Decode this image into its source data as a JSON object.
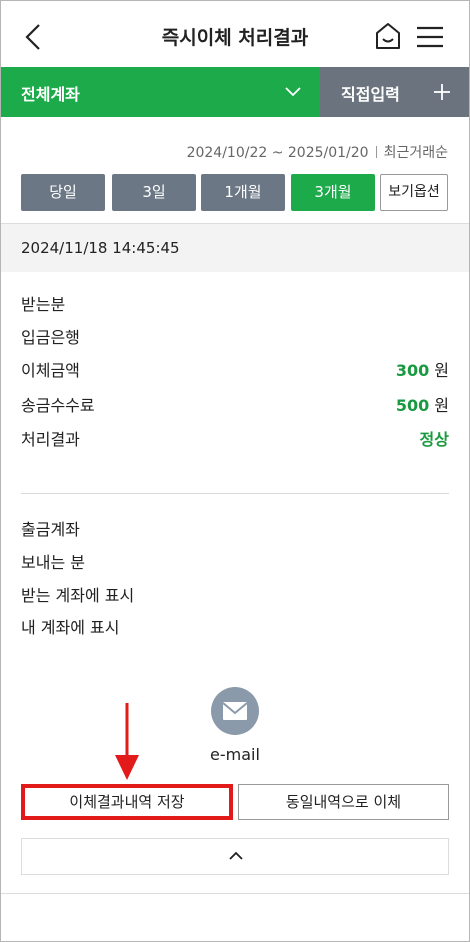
{
  "header": {
    "title": "즉시이체 처리결과",
    "back_icon": "chevron-left-icon",
    "home_icon": "home-icon",
    "menu_icon": "hamburger-menu-icon"
  },
  "account_bar": {
    "all_accounts_label": "전체계좌",
    "direct_input_label": "직접입력"
  },
  "period": {
    "range": "2024/10/22 ~ 2025/01/20",
    "sort": "최근거래순"
  },
  "period_buttons": [
    {
      "label": "당일",
      "active": false
    },
    {
      "label": "3일",
      "active": false
    },
    {
      "label": "1개월",
      "active": false
    },
    {
      "label": "3개월",
      "active": true
    }
  ],
  "view_options_label": "보기옵션",
  "transaction": {
    "datetime": "2024/11/18 14:45:45",
    "fields": [
      {
        "label": "받는분",
        "value": "",
        "unit": ""
      },
      {
        "label": "입금은행",
        "value": "",
        "unit": ""
      },
      {
        "label": "이체금액",
        "value": "300",
        "unit": "원"
      },
      {
        "label": "송금수수료",
        "value": "500",
        "unit": "원"
      },
      {
        "label": "처리결과",
        "value": "정상",
        "unit": ""
      }
    ],
    "extra_fields": [
      {
        "label": "출금계좌"
      },
      {
        "label": "보내는 분"
      },
      {
        "label": "받는 계좌에 표시"
      },
      {
        "label": "내 계좌에 표시"
      }
    ]
  },
  "share": {
    "email_label": "e-mail"
  },
  "actions": {
    "save_label": "이체결과내역 저장",
    "same_transfer_label": "동일내역으로 이체"
  },
  "colors": {
    "accent_green": "#1daa4a",
    "slate": "#6b747e",
    "highlight_red": "#e21a1a"
  }
}
